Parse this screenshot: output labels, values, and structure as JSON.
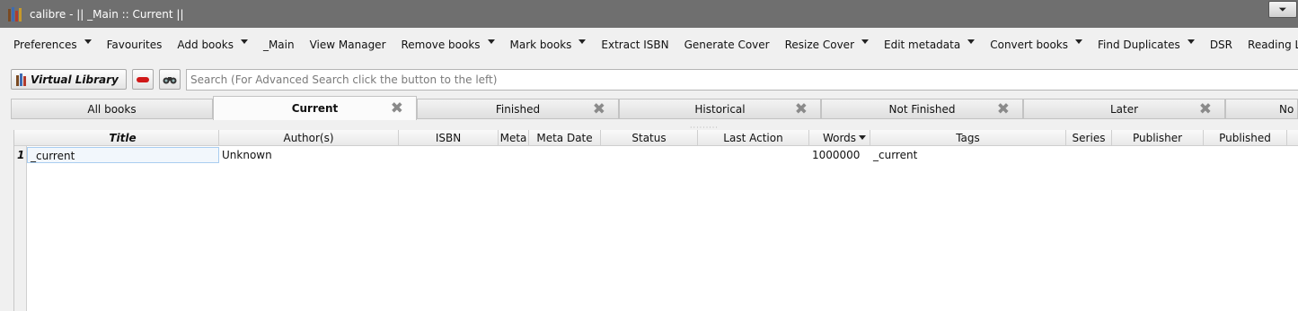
{
  "window": {
    "title": "calibre - || _Main :: Current ||",
    "restore_glyph": "⏷"
  },
  "toolbar": {
    "items": [
      {
        "label": "Preferences",
        "menu": true
      },
      {
        "label": "Favourites",
        "menu": false
      },
      {
        "label": "Add books",
        "menu": true
      },
      {
        "label": "_Main",
        "menu": false
      },
      {
        "label": "View Manager",
        "menu": false
      },
      {
        "label": "Remove books",
        "menu": true
      },
      {
        "label": "Mark books",
        "menu": true
      },
      {
        "label": "Extract ISBN",
        "menu": false
      },
      {
        "label": "Generate Cover",
        "menu": false
      },
      {
        "label": "Resize Cover",
        "menu": true
      },
      {
        "label": "Edit metadata",
        "menu": true
      },
      {
        "label": "Convert books",
        "menu": true
      },
      {
        "label": "Find Duplicates",
        "menu": true
      },
      {
        "label": "DSR",
        "menu": false
      },
      {
        "label": "Reading List",
        "menu": false
      }
    ]
  },
  "search": {
    "virtual_library_label": "Virtual Library",
    "placeholder": "Search (For Advanced Search click the button to the left)",
    "value": ""
  },
  "tabs": [
    {
      "label": "All books",
      "active": false,
      "closable": false
    },
    {
      "label": "Current",
      "active": true,
      "closable": true
    },
    {
      "label": "Finished",
      "active": false,
      "closable": true
    },
    {
      "label": "Historical",
      "active": false,
      "closable": true
    },
    {
      "label": "Not Finished",
      "active": false,
      "closable": true
    },
    {
      "label": "Later",
      "active": false,
      "closable": true
    },
    {
      "label": "No",
      "active": false,
      "closable": false
    }
  ],
  "close_glyph": "✖",
  "table": {
    "columns": [
      "Title",
      "Author(s)",
      "ISBN",
      "Meta",
      "Meta Date",
      "Status",
      "Last Action",
      "Words",
      "Tags",
      "Series",
      "Publisher",
      "Published"
    ],
    "sorted_column": "Words",
    "rows": [
      {
        "row_number": "1",
        "title": "_current",
        "authors": "Unknown",
        "isbn": "",
        "meta": "",
        "meta_date": "",
        "status": "",
        "last_action": "",
        "words": "1000000",
        "tags": "_current",
        "series": "",
        "publisher": "",
        "published": ""
      }
    ]
  },
  "colors": {
    "titlebar": "#6f6f6f",
    "remove_button": "#d01818",
    "selected_cell_border": "#a9cdf0"
  }
}
